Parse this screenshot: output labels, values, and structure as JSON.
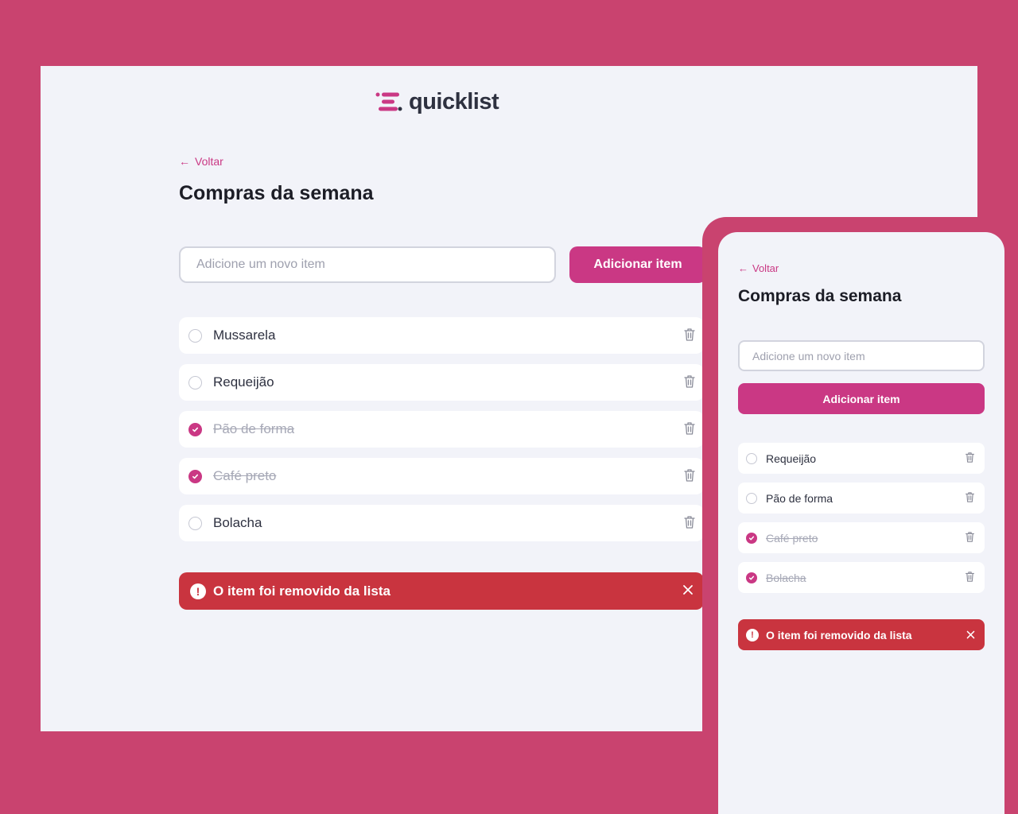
{
  "brand": {
    "name": "quicklist",
    "accent": "#CA3884",
    "danger": "#C9343F",
    "background": "#C9436F"
  },
  "desktop": {
    "back_label": "Voltar",
    "title": "Compras da semana",
    "input_placeholder": "Adicione um novo item",
    "add_button_label": "Adicionar item",
    "items": [
      {
        "label": "Mussarela",
        "checked": false
      },
      {
        "label": "Requeijão",
        "checked": false
      },
      {
        "label": "Pão de forma",
        "checked": true
      },
      {
        "label": "Café preto",
        "checked": true
      },
      {
        "label": "Bolacha",
        "checked": false
      }
    ],
    "toast": {
      "message": "O item foi removido da lista"
    }
  },
  "mobile": {
    "back_label": "Voltar",
    "title": "Compras da semana",
    "input_placeholder": "Adicione um novo item",
    "add_button_label": "Adicionar item",
    "items": [
      {
        "label": "Requeijão",
        "checked": false
      },
      {
        "label": "Pão de forma",
        "checked": false
      },
      {
        "label": "Café preto",
        "checked": true
      },
      {
        "label": "Bolacha",
        "checked": true
      }
    ],
    "toast": {
      "message": "O item foi removido da lista"
    }
  }
}
